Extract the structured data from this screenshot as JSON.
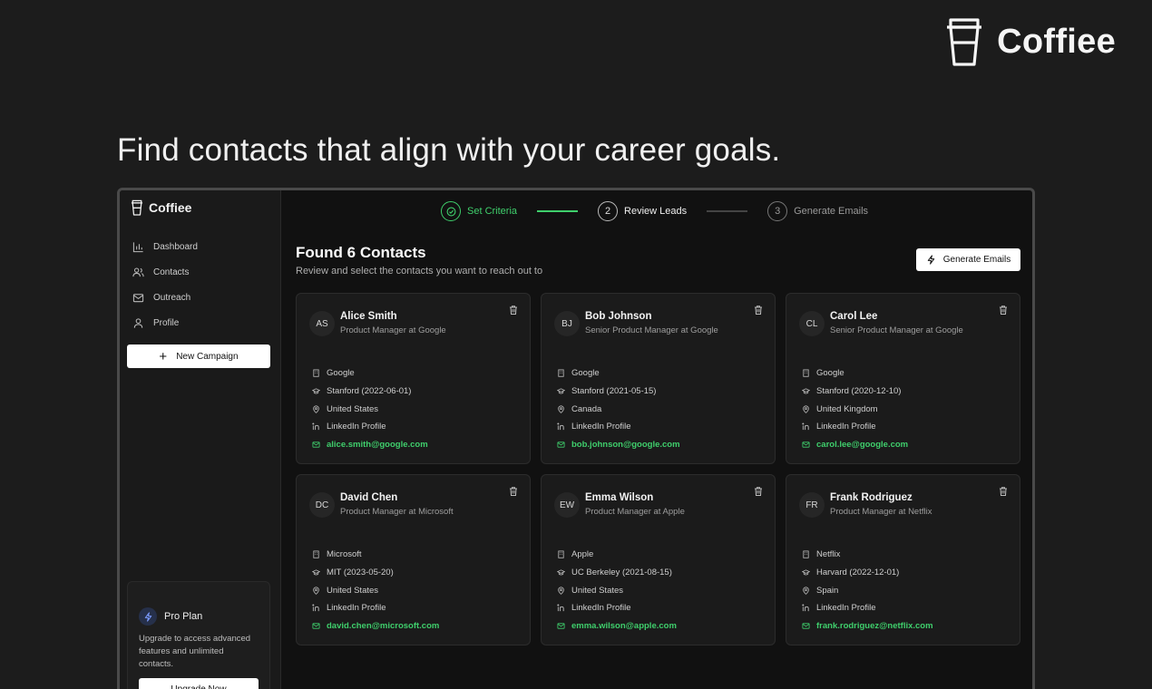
{
  "brand": {
    "name": "Coffiee"
  },
  "hero": {
    "headline": "Find contacts that align with your career goals."
  },
  "app": {
    "sidebar": {
      "logo": "Coffiee",
      "items": [
        {
          "label": "Dashboard",
          "icon": "bar-chart-icon"
        },
        {
          "label": "Contacts",
          "icon": "users-icon"
        },
        {
          "label": "Outreach",
          "icon": "mail-icon"
        },
        {
          "label": "Profile",
          "icon": "user-icon"
        }
      ],
      "new_campaign": "New Campaign",
      "pro": {
        "title": "Pro Plan",
        "description": "Upgrade to access advanced features and unlimited contacts.",
        "button": "Upgrade Now"
      }
    },
    "steps": [
      {
        "number": "1",
        "label": "Set Criteria",
        "state": "done"
      },
      {
        "number": "2",
        "label": "Review Leads",
        "state": "active"
      },
      {
        "number": "3",
        "label": "Generate Emails",
        "state": "todo"
      }
    ],
    "header": {
      "title": "Found 6 Contacts",
      "subtitle": "Review and select the contacts you want to reach out to",
      "generate_button": "Generate Emails"
    },
    "contacts": [
      {
        "initials": "AS",
        "name": "Alice Smith",
        "title": "Product Manager at Google",
        "company": "Google",
        "education": "Stanford (2022-06-01)",
        "location": "United States",
        "linkedin": "LinkedIn Profile",
        "email": "alice.smith@google.com"
      },
      {
        "initials": "BJ",
        "name": "Bob Johnson",
        "title": "Senior Product Manager at Google",
        "company": "Google",
        "education": "Stanford (2021-05-15)",
        "location": "Canada",
        "linkedin": "LinkedIn Profile",
        "email": "bob.johnson@google.com"
      },
      {
        "initials": "CL",
        "name": "Carol Lee",
        "title": "Senior Product Manager at Google",
        "company": "Google",
        "education": "Stanford (2020-12-10)",
        "location": "United Kingdom",
        "linkedin": "LinkedIn Profile",
        "email": "carol.lee@google.com"
      },
      {
        "initials": "DC",
        "name": "David Chen",
        "title": "Product Manager at Microsoft",
        "company": "Microsoft",
        "education": "MIT (2023-05-20)",
        "location": "United States",
        "linkedin": "LinkedIn Profile",
        "email": "david.chen@microsoft.com"
      },
      {
        "initials": "EW",
        "name": "Emma Wilson",
        "title": "Product Manager at Apple",
        "company": "Apple",
        "education": "UC Berkeley (2021-08-15)",
        "location": "United States",
        "linkedin": "LinkedIn Profile",
        "email": "emma.wilson@apple.com"
      },
      {
        "initials": "FR",
        "name": "Frank Rodriguez",
        "title": "Product Manager at Netflix",
        "company": "Netflix",
        "education": "Harvard (2022-12-01)",
        "location": "Spain",
        "linkedin": "LinkedIn Profile",
        "email": "frank.rodriguez@netflix.com"
      }
    ]
  },
  "colors": {
    "accent_green": "#3fcf6c",
    "background": "#1c1c1c",
    "panel": "#111111",
    "card": "#1b1b1b"
  }
}
